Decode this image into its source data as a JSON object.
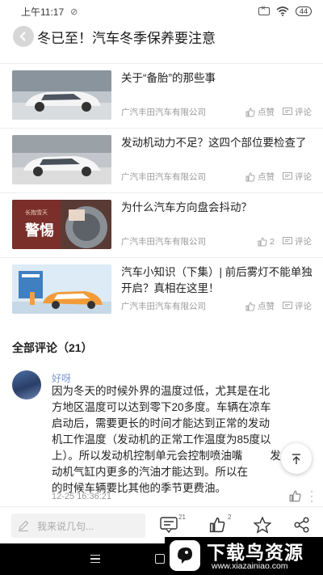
{
  "status_bar": {
    "time": "上午11:17",
    "battery": "44"
  },
  "title_bar": {
    "title": "冬已至！汽车冬季保养要注意"
  },
  "related_articles": [
    {
      "title": "关于“备胎”的那些事",
      "source": "广汽丰田汽车有限公司",
      "likes": "点赞",
      "comments": "评论",
      "thumb_icon": "white-sedan-image"
    },
    {
      "title": "发动机动力不足？这四个部位要检查了",
      "source": "广汽丰田汽车有限公司",
      "likes": "点赞",
      "comments": "评论",
      "thumb_icon": "white-sedan-image"
    },
    {
      "title": "为什么汽车方向盘会抖动？",
      "source": "广汽丰田汽车有限公司",
      "likes": "2",
      "comments": "评论",
      "thumb_icon": "steering-wheel-image",
      "thumb_text": "警惕",
      "thumb_small": "长抱雪天"
    },
    {
      "title": "汽车小知识（下集）| 前后雾灯不能单独开启？真相在这里！",
      "source": "广汽丰田汽车有限公司",
      "likes": "点赞",
      "comments": "评论",
      "thumb_icon": "car-illustration-image"
    }
  ],
  "comments_section": {
    "title": "全部评论（21）",
    "comments": [
      {
        "user": "好呀",
        "lines": [
          "因为冬天的时候外界的温度过低，尤其是在北",
          "方地区温度可以达到零下20多度。车辆在凉车",
          "启动后，需要更长的时间才能达到正常的发动",
          "机工作温度（发动机的正常工作温度为85度以",
          "上）。所以发动机控制单元会控制喷油嘴",
          "动机气缸内更多的汽油才能达到。所以在",
          "的时候车辆要比其他的季节更费油。"
        ],
        "line_tail": "发",
        "time": "12-25 16:36:21"
      }
    ]
  },
  "bottom_bar": {
    "placeholder": "我来说几句...",
    "comment_count": "21",
    "like_count": "2"
  },
  "watermark": {
    "title": "下载鸟资源",
    "url": "www.xiazainiao.com"
  },
  "colors": {
    "username": "#7b9acc",
    "meta": "#999999",
    "nav": "#000000"
  }
}
